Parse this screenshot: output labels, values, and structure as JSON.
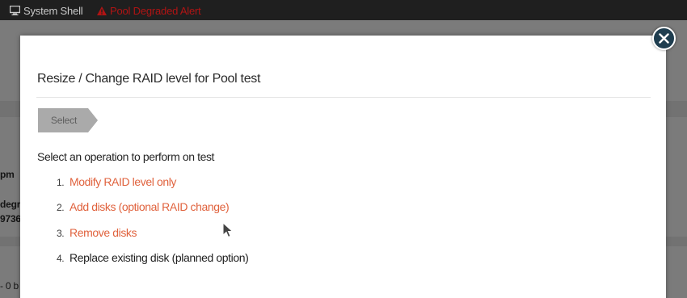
{
  "topbar": {
    "items": [
      {
        "label": "System Shell",
        "icon": "monitor-icon",
        "color": "#c9c9c9"
      },
      {
        "label": "Pool Degraded Alert",
        "icon": "warning-icon",
        "color": "#b01414"
      }
    ]
  },
  "background": {
    "fragments": [
      "pm",
      "degra",
      "9736",
      "- 0 b"
    ]
  },
  "modal": {
    "title": "Resize / Change RAID level for Pool test",
    "step_label": "Select",
    "prompt": "Select an operation to perform on test",
    "operations": [
      {
        "number": "1.",
        "label": "Modify RAID level only",
        "link": true
      },
      {
        "number": "2.",
        "label": "Add disks (optional RAID change)",
        "link": true
      },
      {
        "number": "3.",
        "label": "Remove disks",
        "link": true
      },
      {
        "number": "4.",
        "label": "Replace existing disk (planned option)",
        "link": false
      }
    ],
    "close_icon": "close-icon"
  },
  "colors": {
    "link": "#e0623d",
    "alert": "#b01414",
    "close_button": "#1e3d4f",
    "step_badge": "#aaaaaa"
  }
}
